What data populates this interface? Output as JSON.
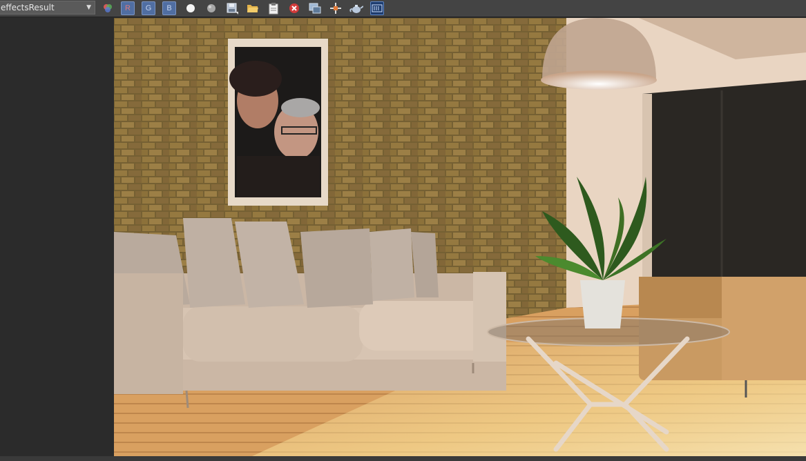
{
  "toolbar": {
    "channel_dropdown": {
      "selected": "effectsResult"
    },
    "red_channel_label": "R",
    "green_channel_label": "G",
    "blue_channel_label": "B",
    "icons": [
      "rgb-display-icon",
      "white-circle-icon",
      "gray-circle-icon",
      "save-icon",
      "open-folder-icon",
      "clipboard-icon",
      "close-red-icon",
      "display-window-icon",
      "region-icon",
      "teapot-render-icon",
      "frame-buffer-icon"
    ]
  },
  "render": {
    "description_text": ""
  },
  "colors": {
    "toolbar_bg": "#444444",
    "panel_bg": "#2b2b2b",
    "channel_button": "#506ea2"
  }
}
